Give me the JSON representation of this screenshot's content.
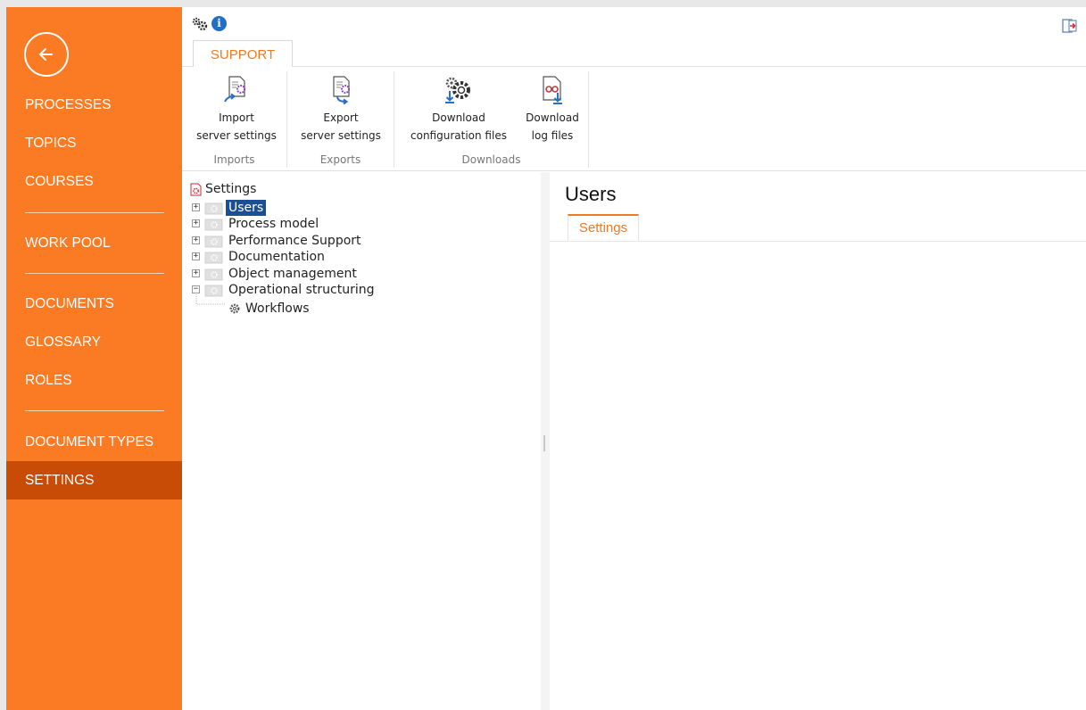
{
  "sidebar": {
    "back_icon": "arrow-left-circle-icon",
    "items": [
      {
        "label": "PROCESSES"
      },
      {
        "label": "TOPICS"
      },
      {
        "label": "COURSES"
      },
      {
        "label": "WORK POOL"
      },
      {
        "label": "DOCUMENTS"
      },
      {
        "label": "GLOSSARY"
      },
      {
        "label": "ROLES"
      },
      {
        "label": "DOCUMENT TYPES"
      },
      {
        "label": "SETTINGS",
        "active": true
      }
    ]
  },
  "topbar": {
    "icons": [
      "gears-icon",
      "info-icon",
      "exit-icon"
    ],
    "info_glyph": "i"
  },
  "ribbon": {
    "tab_label": "SUPPORT",
    "groups": [
      {
        "label": "Imports",
        "buttons": [
          {
            "line1": "Import",
            "line2": "server settings",
            "icon": "import-settings-icon"
          }
        ]
      },
      {
        "label": "Exports",
        "buttons": [
          {
            "line1": "Export",
            "line2": "server settings",
            "icon": "export-settings-icon"
          }
        ]
      },
      {
        "label": "Downloads",
        "buttons": [
          {
            "line1": "Download",
            "line2": "configuration files",
            "icon": "download-config-icon"
          },
          {
            "line1": "Download",
            "line2": "log files",
            "icon": "download-log-icon"
          }
        ]
      }
    ]
  },
  "tree": {
    "root": "Settings",
    "items": [
      {
        "label": "Users",
        "expander": "+",
        "selected": true
      },
      {
        "label": "Process model",
        "expander": "+"
      },
      {
        "label": "Performance Support",
        "expander": "+"
      },
      {
        "label": "Documentation",
        "expander": "+"
      },
      {
        "label": "Object management",
        "expander": "+"
      },
      {
        "label": "Operational structuring",
        "expander": "−"
      }
    ],
    "child": "Workflows"
  },
  "detail": {
    "title": "Users",
    "tab_label": "Settings"
  },
  "colors": {
    "sidebar": "#fb7b24",
    "sidebar_active": "#c84c06",
    "accent": "#f07a24",
    "selection": "#1c4f93"
  }
}
